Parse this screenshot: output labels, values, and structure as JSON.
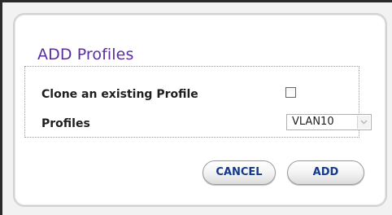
{
  "dialog": {
    "title": "ADD Profiles",
    "clone_label": "Clone an existing Profile",
    "clone_checked": false,
    "profiles_label": "Profiles",
    "profiles_selected": "VLAN10",
    "cancel_label": "CANCEL",
    "add_label": "ADD"
  },
  "colors": {
    "title": "#5a2d9c",
    "button_text": "#153a8a"
  },
  "icons": [
    "chevron-down-icon"
  ]
}
